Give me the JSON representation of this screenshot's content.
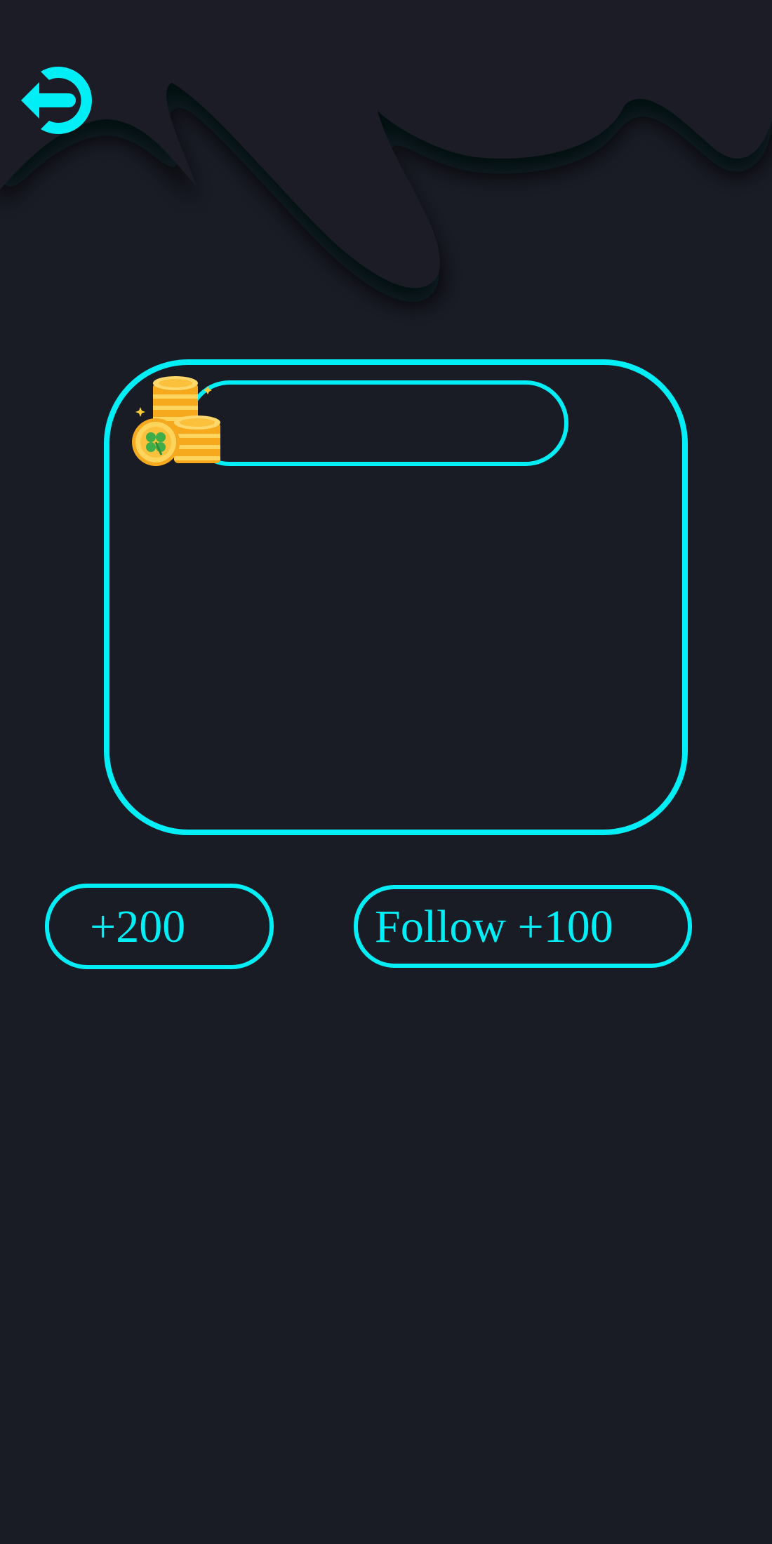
{
  "colors": {
    "background": "#191b25",
    "accent": "#00eef5",
    "coin_gold": "#fdbb2c"
  },
  "header": {
    "back_icon": "logout-arrow-icon"
  },
  "balance_panel": {
    "coin_icon": "coin-stack-clover-icon",
    "coin_value": ""
  },
  "rewards": {
    "daily_label": "+200",
    "follow_label": "Follow +100"
  }
}
